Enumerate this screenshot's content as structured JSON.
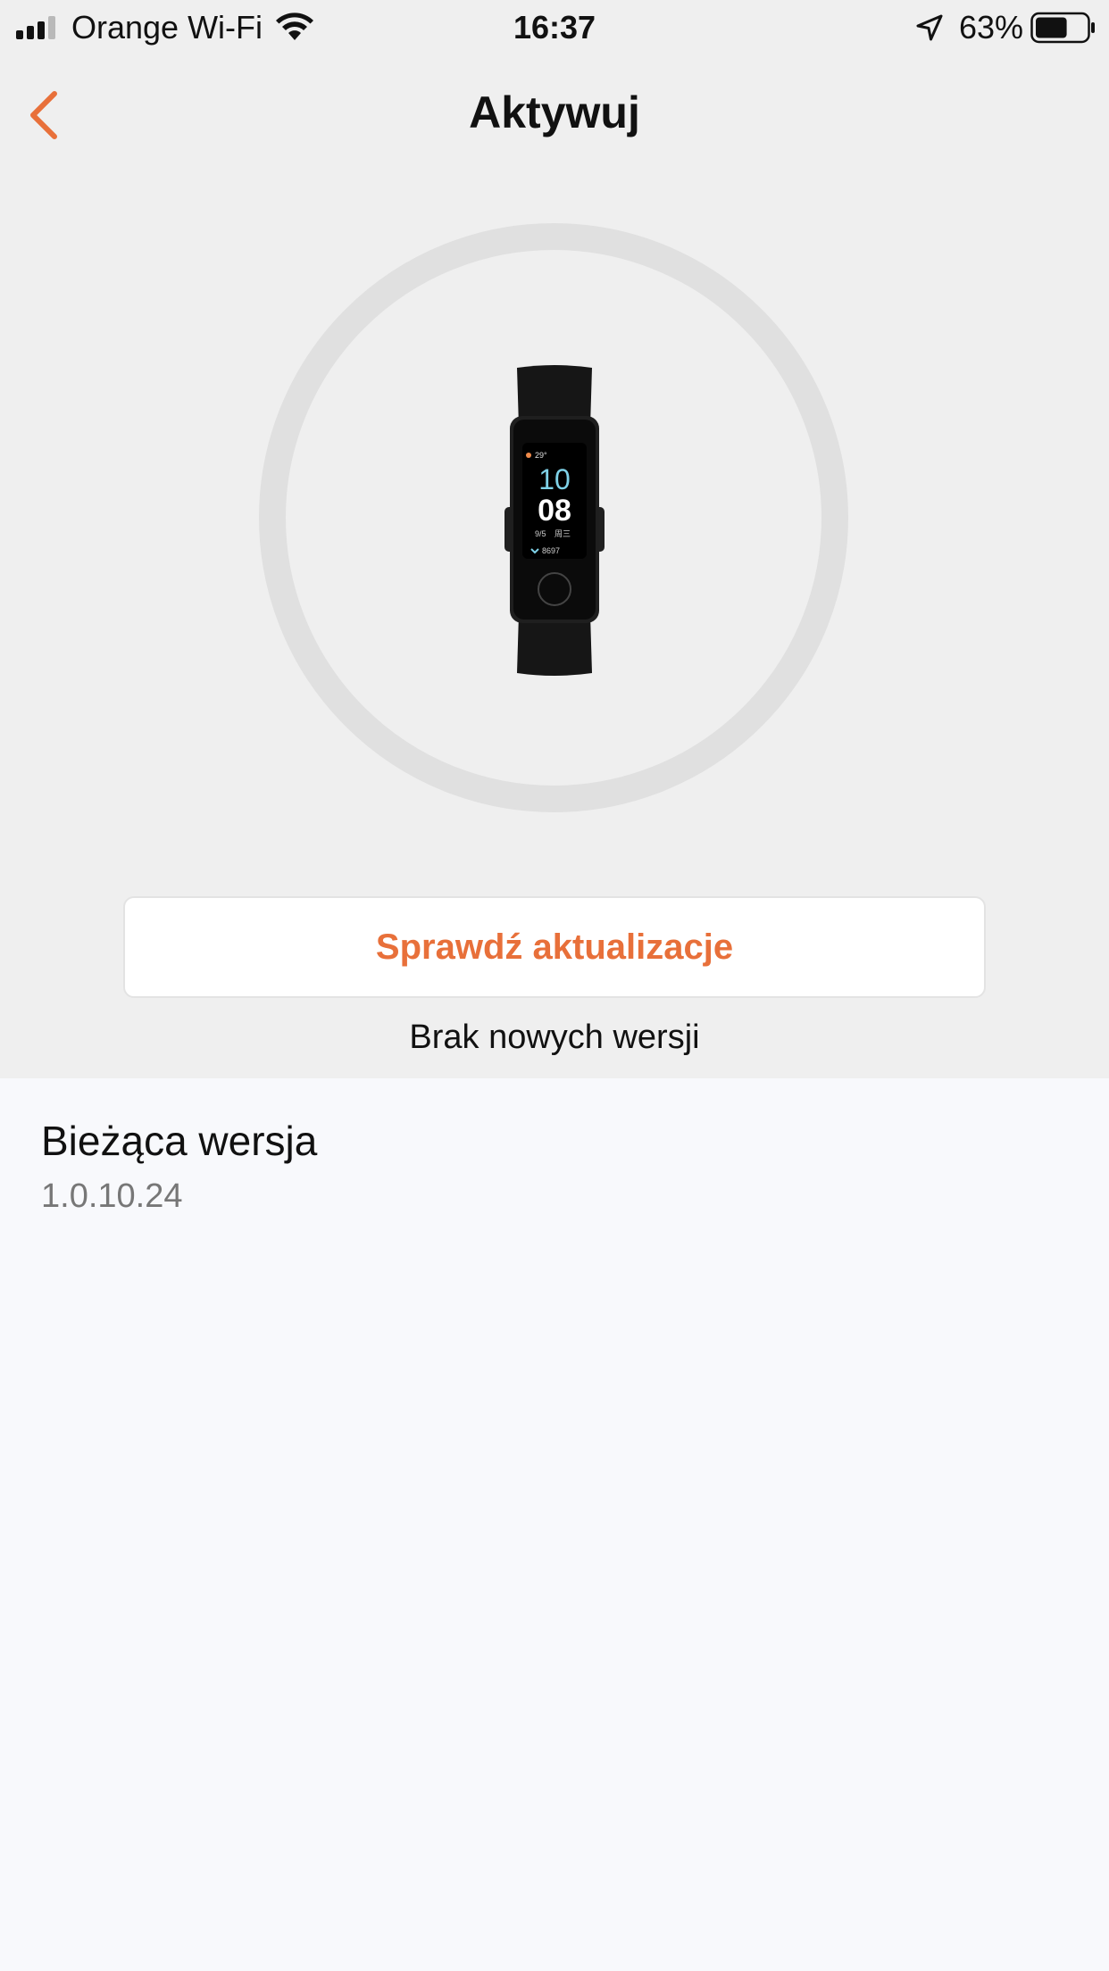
{
  "status_bar": {
    "carrier": "Orange Wi-Fi",
    "time": "16:37",
    "battery": "63%",
    "battery_level": 0.63,
    "signal_bars": 3,
    "signal_total": 4
  },
  "nav": {
    "title": "Aktywuj",
    "back_icon": "chevron-left-icon"
  },
  "device": {
    "screen": {
      "weather": "29°",
      "hour": "10",
      "minute": "08",
      "date": "9/5",
      "weekday": "周三",
      "steps": "8697"
    }
  },
  "update": {
    "button_label": "Sprawdź aktualizacje",
    "status_text": "Brak nowych wersji"
  },
  "version": {
    "label": "Bieżąca wersja",
    "value": "1.0.10.24"
  },
  "colors": {
    "accent": "#e8703a",
    "top_background": "#efefef",
    "page_background": "#f8f9fc",
    "ring": "#e0e0e0",
    "secondary_text": "#777777"
  }
}
